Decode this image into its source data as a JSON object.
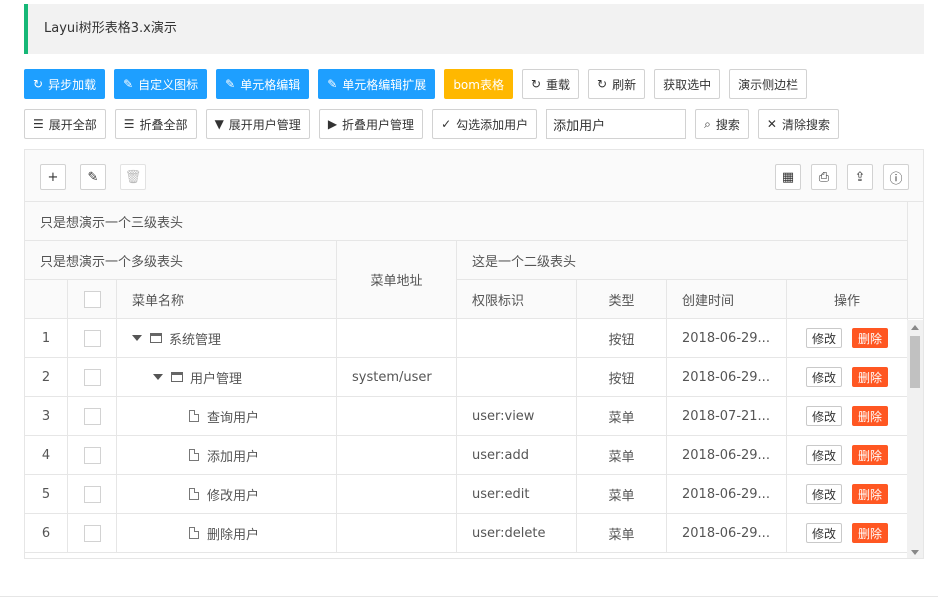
{
  "page": {
    "title": "Layui树形表格3.x演示"
  },
  "toolbar_row1": [
    {
      "label": "异步加载",
      "icon": "↻",
      "style": "blue",
      "name": "async-load-button"
    },
    {
      "label": "自定义图标",
      "icon": "✎",
      "style": "blue",
      "name": "custom-icon-button"
    },
    {
      "label": "单元格编辑",
      "icon": "✎",
      "style": "blue",
      "name": "cell-edit-button"
    },
    {
      "label": "单元格编辑扩展",
      "icon": "✎",
      "style": "blue",
      "name": "cell-edit-ext-button"
    },
    {
      "label": "bom表格",
      "icon": "",
      "style": "orange",
      "name": "bom-table-button"
    },
    {
      "label": "重载",
      "icon": "↻",
      "style": "plain",
      "name": "reload-button"
    },
    {
      "label": "刷新",
      "icon": "↻",
      "style": "plain",
      "name": "refresh-button"
    },
    {
      "label": "获取选中",
      "icon": "",
      "style": "plain",
      "name": "get-selected-button"
    },
    {
      "label": "演示侧边栏",
      "icon": "",
      "style": "plain",
      "name": "demo-sidebar-button"
    }
  ],
  "toolbar_row2": [
    {
      "label": "展开全部",
      "icon": "☰",
      "name": "expand-all-button"
    },
    {
      "label": "折叠全部",
      "icon": "☰",
      "name": "collapse-all-button"
    },
    {
      "label": "展开用户管理",
      "icon": "▼",
      "name": "expand-user-mgmt-button"
    },
    {
      "label": "折叠用户管理",
      "icon": "▶",
      "name": "collapse-user-mgmt-button"
    },
    {
      "label": "勾选添加用户",
      "icon": "✓",
      "name": "check-add-user-button"
    }
  ],
  "search": {
    "value": "添加用户",
    "button": "搜索",
    "clear": "清除搜索"
  },
  "table_toolbar": {
    "add_icon": "+",
    "edit_icon": "✎",
    "delete_icon": "🗑",
    "cols_icon": "▦",
    "print_icon": "⎙",
    "export_icon": "⇪",
    "info_icon": "ⓘ"
  },
  "headers": {
    "level3": "只是想演示一个三级表头",
    "multi": "只是想演示一个多级表头",
    "menu_url": "菜单地址",
    "level2": "这是一个二级表头",
    "menu_name": "菜单名称",
    "perm": "权限标识",
    "type": "类型",
    "created": "创建时间",
    "ops": "操作"
  },
  "rows": [
    {
      "no": "1",
      "level": 0,
      "kind": "folder",
      "expand": true,
      "name": "系统管理",
      "url": "",
      "perm": "",
      "type": "按钮",
      "created": "2018-06-29..."
    },
    {
      "no": "2",
      "level": 1,
      "kind": "folder",
      "expand": true,
      "name": "用户管理",
      "url": "system/user",
      "perm": "",
      "type": "按钮",
      "created": "2018-06-29..."
    },
    {
      "no": "3",
      "level": 2,
      "kind": "file",
      "expand": false,
      "name": "查询用户",
      "url": "",
      "perm": "user:view",
      "type": "菜单",
      "created": "2018-07-21..."
    },
    {
      "no": "4",
      "level": 2,
      "kind": "file",
      "expand": false,
      "name": "添加用户",
      "url": "",
      "perm": "user:add",
      "type": "菜单",
      "created": "2018-06-29..."
    },
    {
      "no": "5",
      "level": 2,
      "kind": "file",
      "expand": false,
      "name": "修改用户",
      "url": "",
      "perm": "user:edit",
      "type": "菜单",
      "created": "2018-06-29..."
    },
    {
      "no": "6",
      "level": 2,
      "kind": "file",
      "expand": false,
      "name": "删除用户",
      "url": "",
      "perm": "user:delete",
      "type": "菜单",
      "created": "2018-06-29..."
    }
  ],
  "ops": {
    "edit": "修改",
    "delete": "删除"
  },
  "colors": {
    "primary": "#1e9fff",
    "warn": "#ffb800",
    "danger": "#ff5722",
    "accent": "#16b777"
  }
}
